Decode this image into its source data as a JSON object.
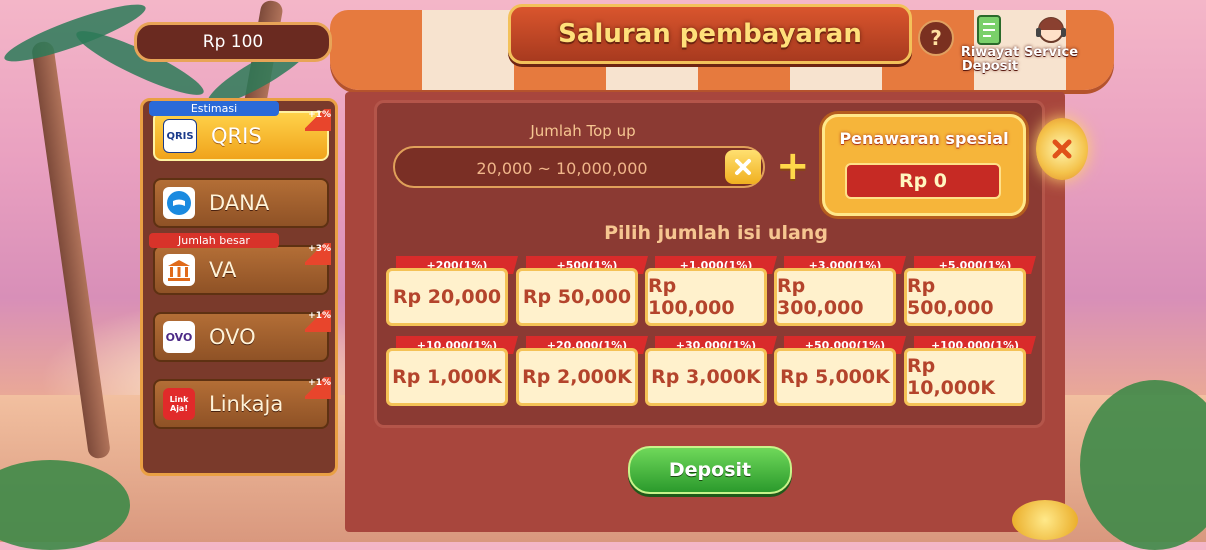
{
  "header": {
    "balance": "Rp 100",
    "title": "Saluran pembayaran",
    "help_symbol": "?",
    "history_label_line1": "Riwayat",
    "history_label_line2": "Deposit",
    "service_label": "Service"
  },
  "sidebar": {
    "tags": {
      "estimasi": "Estimasi",
      "jumlah_besar": "Jumlah besar"
    },
    "items": [
      {
        "name": "QRIS",
        "logo_text": "QRIS",
        "badge": "+1%",
        "active": true
      },
      {
        "name": "DANA",
        "logo_text": "",
        "badge": "",
        "active": false
      },
      {
        "name": "VA",
        "logo_text": "",
        "badge": "+3%",
        "active": false
      },
      {
        "name": "OVO",
        "logo_text": "OVO",
        "badge": "+1%",
        "active": false
      },
      {
        "name": "Linkaja",
        "logo_text": "Link Aja!",
        "badge": "+1%",
        "active": false
      }
    ]
  },
  "topup": {
    "label": "Jumlah Top up",
    "placeholder": "20,000 ~ 10,000,000",
    "value": ""
  },
  "special_offer": {
    "title": "Penawaran spesial",
    "value": "Rp 0"
  },
  "choose_label": "Pilih jumlah isi ulang",
  "amounts": [
    {
      "bonus": "+200(1%)",
      "amount": "Rp 20,000"
    },
    {
      "bonus": "+500(1%)",
      "amount": "Rp 50,000"
    },
    {
      "bonus": "+1,000(1%)",
      "amount": "Rp 100,000"
    },
    {
      "bonus": "+3,000(1%)",
      "amount": "Rp 300,000"
    },
    {
      "bonus": "+5,000(1%)",
      "amount": "Rp 500,000"
    },
    {
      "bonus": "+10,000(1%)",
      "amount": "Rp 1,000K"
    },
    {
      "bonus": "+20,000(1%)",
      "amount": "Rp 2,000K"
    },
    {
      "bonus": "+30,000(1%)",
      "amount": "Rp 3,000K"
    },
    {
      "bonus": "+50,000(1%)",
      "amount": "Rp 5,000K"
    },
    {
      "bonus": "+100,000(1%)",
      "amount": "Rp 10,000K"
    }
  ],
  "deposit_label": "Deposit",
  "colors": {
    "accent": "#f0a31c",
    "danger": "#d92b2b",
    "confirm": "#2b9a2c",
    "panel": "#8b3a33"
  }
}
